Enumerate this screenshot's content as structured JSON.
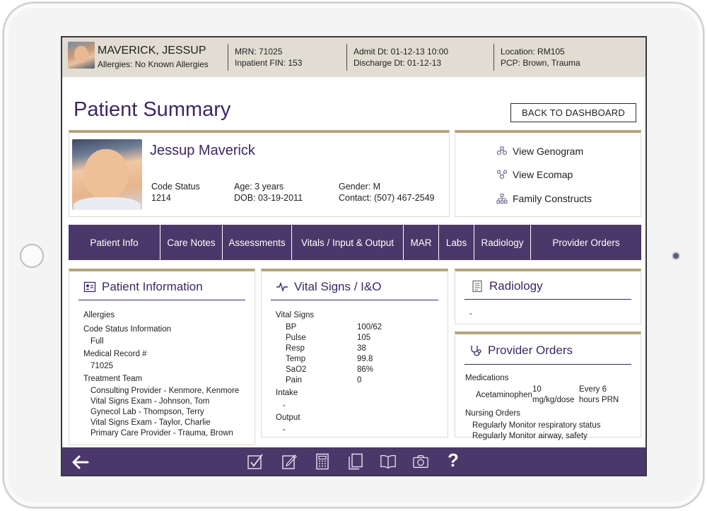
{
  "banner": {
    "patient_name": "MAVERICK, JESSUP",
    "allergies": "Allergies: No Known Allergies",
    "mrn": "MRN: 71025",
    "fin": "Inpatient FIN: 153",
    "admit": "Admit Dt: 01-12-13 10:00",
    "discharge": "Discharge Dt: 01-12-13",
    "location": "Location: RM105",
    "pcp": "PCP: Brown, Trauma"
  },
  "page": {
    "title": "Patient Summary",
    "back_label": "BACK TO DASHBOARD"
  },
  "patient_card": {
    "name": "Jessup Maverick",
    "code_status_label": "Code Status",
    "code_status_value": "1214",
    "age": "Age: 3 years",
    "dob": "DOB: 03-19-2011",
    "gender": "Gender: M",
    "contact": "Contact: (507) 467-2549"
  },
  "family_links": [
    {
      "label": "View Genogram",
      "icon": "genogram-icon"
    },
    {
      "label": "View Ecomap",
      "icon": "ecomap-icon"
    },
    {
      "label": "Family Constructs",
      "icon": "family-tree-icon"
    }
  ],
  "nav_tabs": [
    "Patient Info",
    "Care Notes",
    "Assessments",
    "Vitals / Input & Output",
    "MAR",
    "Labs",
    "Radiology",
    "Provider Orders"
  ],
  "patient_info": {
    "title": "Patient Information",
    "allergies_label": "Allergies",
    "code_status_label": "Code Status Information",
    "code_status_value": "Full",
    "mrn_label": "Medical Record #",
    "mrn_value": "71025",
    "team_label": "Treatment Team",
    "team": [
      "Consulting Provider - Kenmore, Kenmore",
      "Vital Signs Exam - Johnson, Tom",
      "Gynecol Lab - Thompson, Terry",
      "Vital Signs Exam - Taylor, Charlie",
      "Primary Care Provider - Trauma, Brown"
    ]
  },
  "vitals": {
    "title": "Vital Signs / I&O",
    "section_label": "Vital Signs",
    "rows": [
      {
        "name": "BP",
        "value": "100/62"
      },
      {
        "name": "Pulse",
        "value": "105"
      },
      {
        "name": "Resp",
        "value": "38"
      },
      {
        "name": "Temp",
        "value": "99.8"
      },
      {
        "name": "SaO2",
        "value": "86%"
      },
      {
        "name": "Pain",
        "value": "0"
      }
    ],
    "intake_label": "Intake",
    "intake_value": "-",
    "output_label": "Output",
    "output_value": "-"
  },
  "radiology": {
    "title": "Radiology",
    "value": "-"
  },
  "provider_orders": {
    "title": "Provider Orders",
    "medications_label": "Medications",
    "med_name": "Acetaminophen",
    "med_dose_1": "10",
    "med_dose_2": "mg/kg/dose",
    "med_freq_1": "Every 6",
    "med_freq_2": "hours PRN",
    "nursing_label": "Nursing Orders",
    "nursing": [
      "Regularly Monitor respiratory status",
      "Regularly Monitor airway, safety"
    ]
  },
  "footer_icons": [
    "checklist-icon",
    "notepad-icon",
    "calculator-icon",
    "documents-icon",
    "book-icon",
    "camera-icon",
    "help-icon"
  ],
  "footer_help": "?",
  "colors": {
    "brand_purple": "#4b3769",
    "title_purple": "#3d2763",
    "gold_accent": "#b5a57c",
    "banner_bg": "#e2ddd3"
  }
}
